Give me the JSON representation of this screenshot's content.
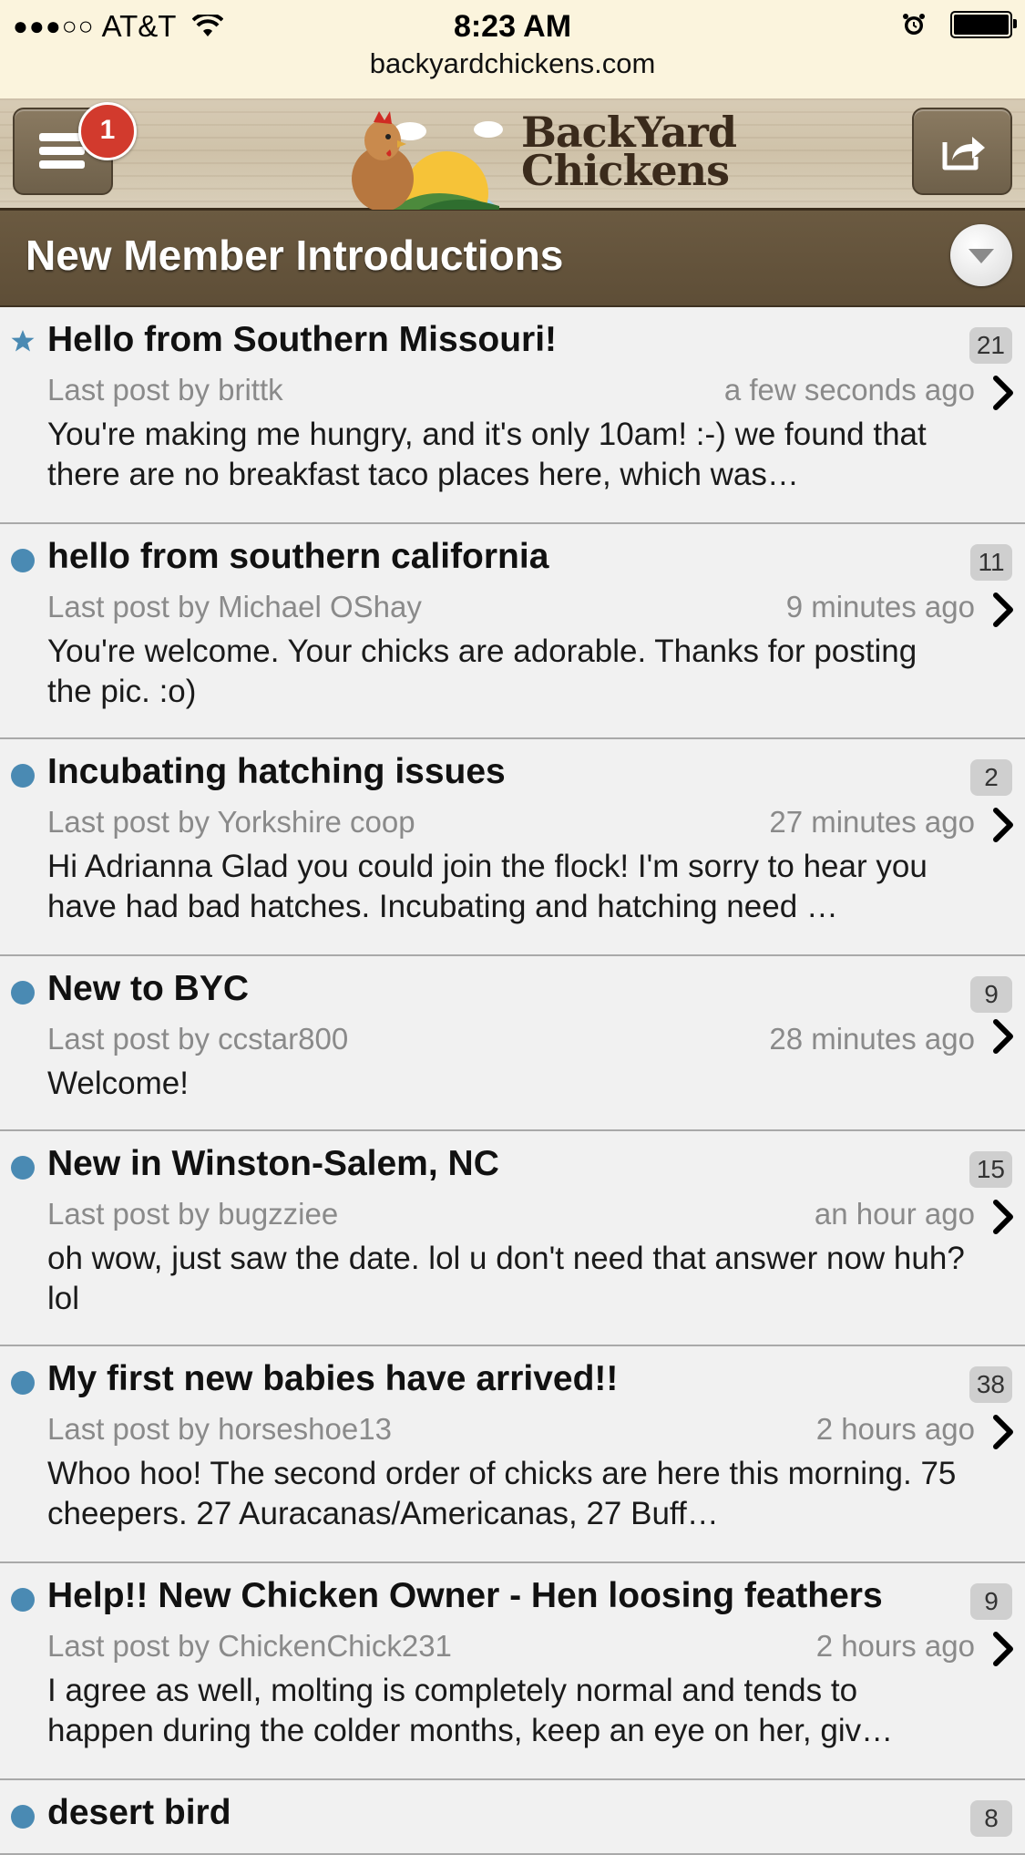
{
  "status": {
    "signal_dots": "●●●○○",
    "carrier": "AT&T",
    "time": "8:23 AM"
  },
  "url": "backyardchickens.com",
  "header": {
    "notification_count": "1",
    "logo_text_line1": "BackYard",
    "logo_text_line2": "Chickens"
  },
  "section": {
    "title": "New Member Introductions"
  },
  "threads": [
    {
      "marker": "star",
      "title": "Hello from Southern Missouri!",
      "count": "21",
      "last_post_by": "Last post by brittk",
      "time": "a few seconds ago",
      "preview": "You're making me hungry, and it's only 10am! :-) we found that there are no breakfast taco places here, which was…"
    },
    {
      "marker": "dot",
      "title": "hello from southern california",
      "count": "11",
      "last_post_by": "Last post by Michael OShay",
      "time": "9 minutes ago",
      "preview": "You're welcome. Your chicks are adorable. Thanks for posting the pic. :o)"
    },
    {
      "marker": "dot",
      "title": "Incubating hatching issues",
      "count": "2",
      "last_post_by": "Last post by Yorkshire coop",
      "time": "27 minutes ago",
      "preview": "Hi Adrianna Glad you could join the flock! I'm sorry to hear you have had bad hatches. Incubating and hatching need …"
    },
    {
      "marker": "dot",
      "title": "New to BYC",
      "count": "9",
      "last_post_by": "Last post by ccstar800",
      "time": "28 minutes ago",
      "preview": "Welcome!"
    },
    {
      "marker": "dot",
      "title": "New in Winston-Salem, NC",
      "count": "15",
      "last_post_by": "Last post by bugzziee",
      "time": "an hour ago",
      "preview": "oh wow, just saw the date. lol u don't need that answer now huh? lol"
    },
    {
      "marker": "dot",
      "title": "My first new babies have arrived!!",
      "count": "38",
      "last_post_by": "Last post by horseshoe13",
      "time": "2 hours ago",
      "preview": "Whoo hoo! The second order of chicks are here this morning. 75 cheepers. 27 Auracanas/Americanas, 27 Buff…"
    },
    {
      "marker": "dot",
      "title": "Help!! New Chicken Owner - Hen loosing feathers",
      "count": "9",
      "last_post_by": "Last post by ChickenChick231",
      "time": "2 hours ago",
      "preview": "I agree as well, molting is completely normal and tends to happen during the colder months, keep an eye on her, giv…"
    },
    {
      "marker": "dot",
      "title": "desert bird",
      "count": "8",
      "last_post_by": "",
      "time": "",
      "preview": ""
    }
  ],
  "colors": {
    "unread_dot": "#4a8ab3",
    "section_bar": "#5e4e37",
    "badge": "#d23a2d"
  }
}
